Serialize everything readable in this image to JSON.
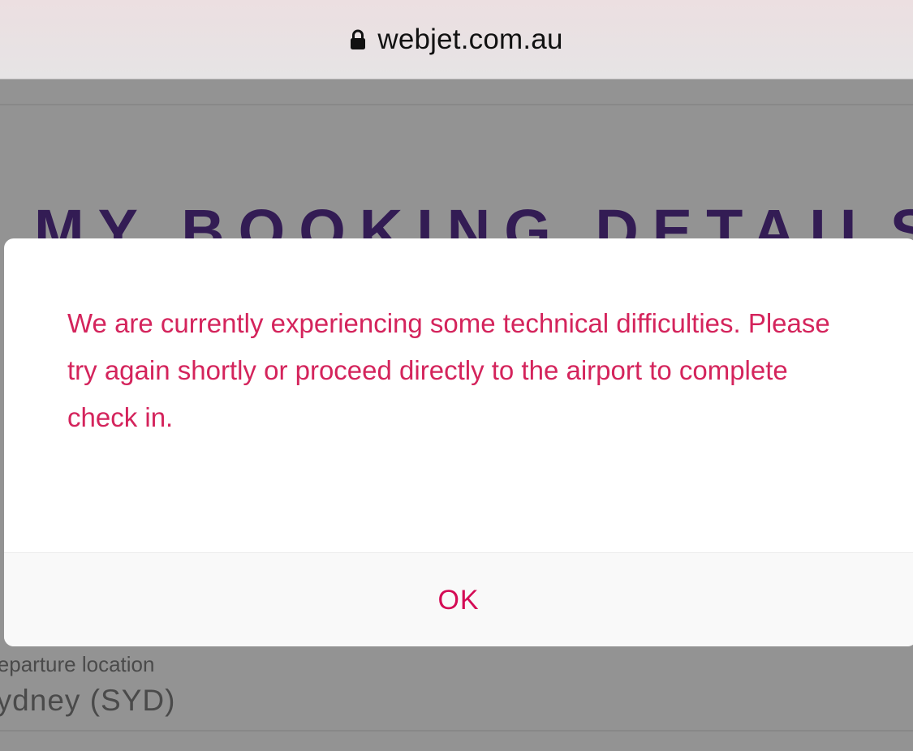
{
  "browser": {
    "url": "webjet.com.au",
    "lock_icon": "lock-icon"
  },
  "page": {
    "title": "MY BOOKING DETAILS",
    "departure_label": "Departure location",
    "departure_value": "Sydney (SYD)"
  },
  "dialog": {
    "message": "We are currently experiencing some technical difficulties. Please try again shortly or proceed directly to the airport to complete check in.",
    "ok_label": "OK"
  },
  "colors": {
    "message_text": "#d4245c",
    "ok_text": "#d40b55",
    "title_text": "#331c54",
    "overlay": "#939393"
  }
}
